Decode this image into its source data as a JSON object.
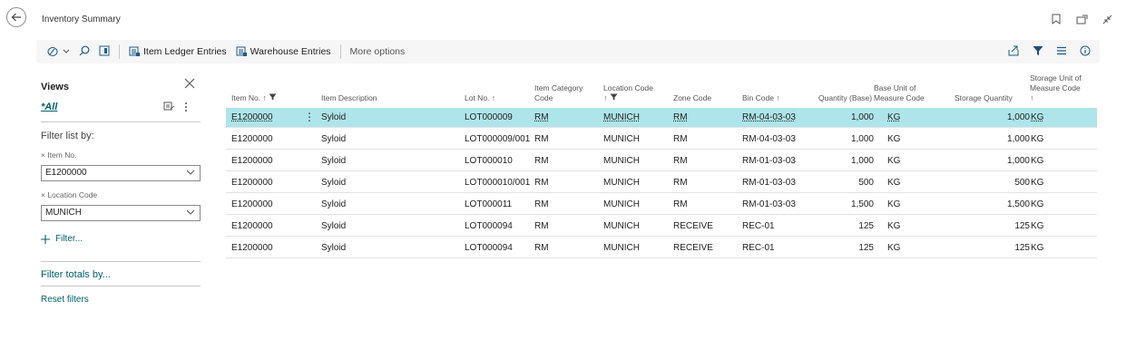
{
  "window": {
    "title": "Inventory Summary"
  },
  "actions": {
    "item_ledger": "Item Ledger Entries",
    "warehouse": "Warehouse Entries",
    "more": "More options"
  },
  "filter_pane": {
    "views_title": "Views",
    "view_all": "*All",
    "filter_list_by": "Filter list by:",
    "filters": [
      {
        "label": "Item No.",
        "value": "E1200000"
      },
      {
        "label": "Location Code",
        "value": "MUNICH"
      }
    ],
    "add_filter": "Filter...",
    "filter_totals": "Filter totals by...",
    "reset": "Reset filters"
  },
  "table": {
    "headers": {
      "item_no": "Item No. ↑",
      "desc": "Item Description",
      "lot": "Lot No. ↑",
      "cat_1": "Item Category",
      "cat_2": "Code",
      "loc_1": "Location Code",
      "loc_2": "↑",
      "zone": "Zone Code",
      "bin": "Bin Code ↑",
      "qty": "Quantity (Base)",
      "base_1": "Base Unit of",
      "base_2": "Measure Code",
      "storage_qty": "Storage Quantity",
      "su_1": "Storage Unit of",
      "su_2": "Measure Code",
      "su_3": "↑"
    },
    "rows": [
      [
        "E1200000",
        "Syloid",
        "LOT000009",
        "RM",
        "MUNICH",
        "RM",
        "RM-04-03-03",
        "1,000",
        "KG",
        "1,000",
        "KG"
      ],
      [
        "E1200000",
        "Syloid",
        "LOT000009/001",
        "RM",
        "MUNICH",
        "RM",
        "RM-04-03-03",
        "1,000",
        "KG",
        "1,000",
        "KG"
      ],
      [
        "E1200000",
        "Syloid",
        "LOT000010",
        "RM",
        "MUNICH",
        "RM",
        "RM-01-03-03",
        "1,000",
        "KG",
        "1,000",
        "KG"
      ],
      [
        "E1200000",
        "Syloid",
        "LOT000010/001",
        "RM",
        "MUNICH",
        "RM",
        "RM-01-03-03",
        "500",
        "KG",
        "500",
        "KG"
      ],
      [
        "E1200000",
        "Syloid",
        "LOT000011",
        "RM",
        "MUNICH",
        "RM",
        "RM-01-03-03",
        "1,500",
        "KG",
        "1,500",
        "KG"
      ],
      [
        "E1200000",
        "Syloid",
        "LOT000094",
        "RM",
        "MUNICH",
        "RECEIVE",
        "REC-01",
        "125",
        "KG",
        "125",
        "KG"
      ],
      [
        "E1200000",
        "Syloid",
        "LOT000094",
        "RM",
        "MUNICH",
        "RECEIVE",
        "REC-01",
        "125",
        "KG",
        "125",
        "KG"
      ]
    ]
  },
  "colors": {
    "accent": "#00606b",
    "selected_row": "#aee5ea",
    "actionbar_bg": "#f6f6f6"
  }
}
